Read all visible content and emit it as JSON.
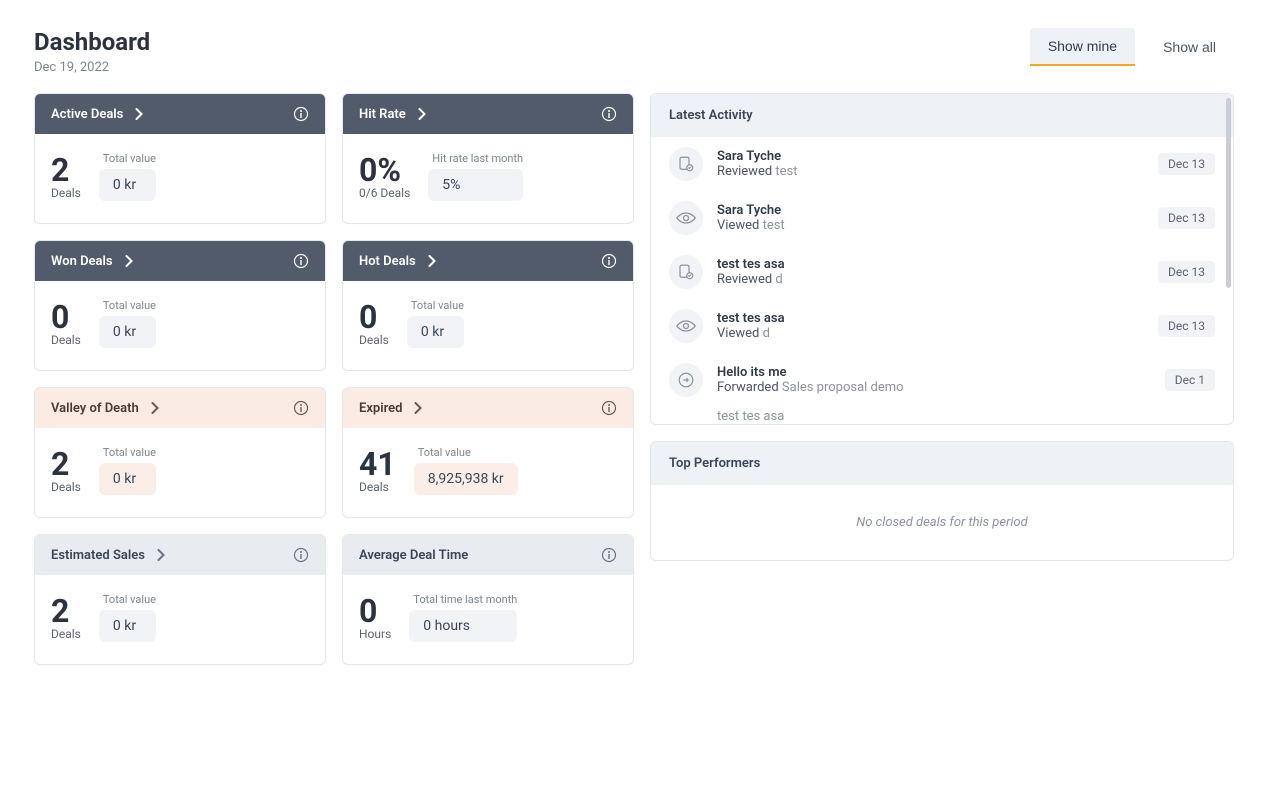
{
  "header": {
    "title": "Dashboard",
    "date": "Dec 19, 2022",
    "tabs": {
      "show_mine": "Show mine",
      "show_all": "Show all"
    }
  },
  "cards": {
    "active_deals": {
      "title": "Active Deals",
      "big": "2",
      "unit": "Deals",
      "value_label": "Total value",
      "value": "0 kr"
    },
    "hit_rate": {
      "title": "Hit Rate",
      "big": "0%",
      "unit": "0/6 Deals",
      "value_label": "Hit rate last month",
      "value": "5%"
    },
    "won_deals": {
      "title": "Won Deals",
      "big": "0",
      "unit": "Deals",
      "value_label": "Total value",
      "value": "0 kr"
    },
    "hot_deals": {
      "title": "Hot Deals",
      "big": "0",
      "unit": "Deals",
      "value_label": "Total value",
      "value": "0 kr"
    },
    "valley": {
      "title": "Valley of Death",
      "big": "2",
      "unit": "Deals",
      "value_label": "Total value",
      "value": "0 kr"
    },
    "expired": {
      "title": "Expired",
      "big": "41",
      "unit": "Deals",
      "value_label": "Total value",
      "value": "8,925,938 kr"
    },
    "estimated": {
      "title": "Estimated Sales",
      "big": "2",
      "unit": "Deals",
      "value_label": "Total value",
      "value": "0 kr"
    },
    "avg_deal_time": {
      "title": "Average Deal Time",
      "big": "0",
      "unit": "Hours",
      "value_label": "Total time last month",
      "value": "0 hours"
    }
  },
  "latest_activity": {
    "title": "Latest Activity",
    "items": [
      {
        "icon": "reviewed",
        "who": "Sara Tyche",
        "verb": "Reviewed",
        "obj": "test",
        "date": "Dec 13"
      },
      {
        "icon": "viewed",
        "who": "Sara Tyche",
        "verb": "Viewed",
        "obj": "test",
        "date": "Dec 13"
      },
      {
        "icon": "reviewed",
        "who": "test tes asa",
        "verb": "Reviewed",
        "obj": "d",
        "date": "Dec 13"
      },
      {
        "icon": "viewed",
        "who": "test tes asa",
        "verb": "Viewed",
        "obj": "d",
        "date": "Dec 13"
      },
      {
        "icon": "forwarded",
        "who": "Hello its me",
        "verb": "Forwarded",
        "obj": "Sales proposal demo",
        "date": "Dec 1"
      }
    ],
    "cutoff": "test tes asa"
  },
  "top_performers": {
    "title": "Top Performers",
    "empty": "No closed deals for this period"
  }
}
